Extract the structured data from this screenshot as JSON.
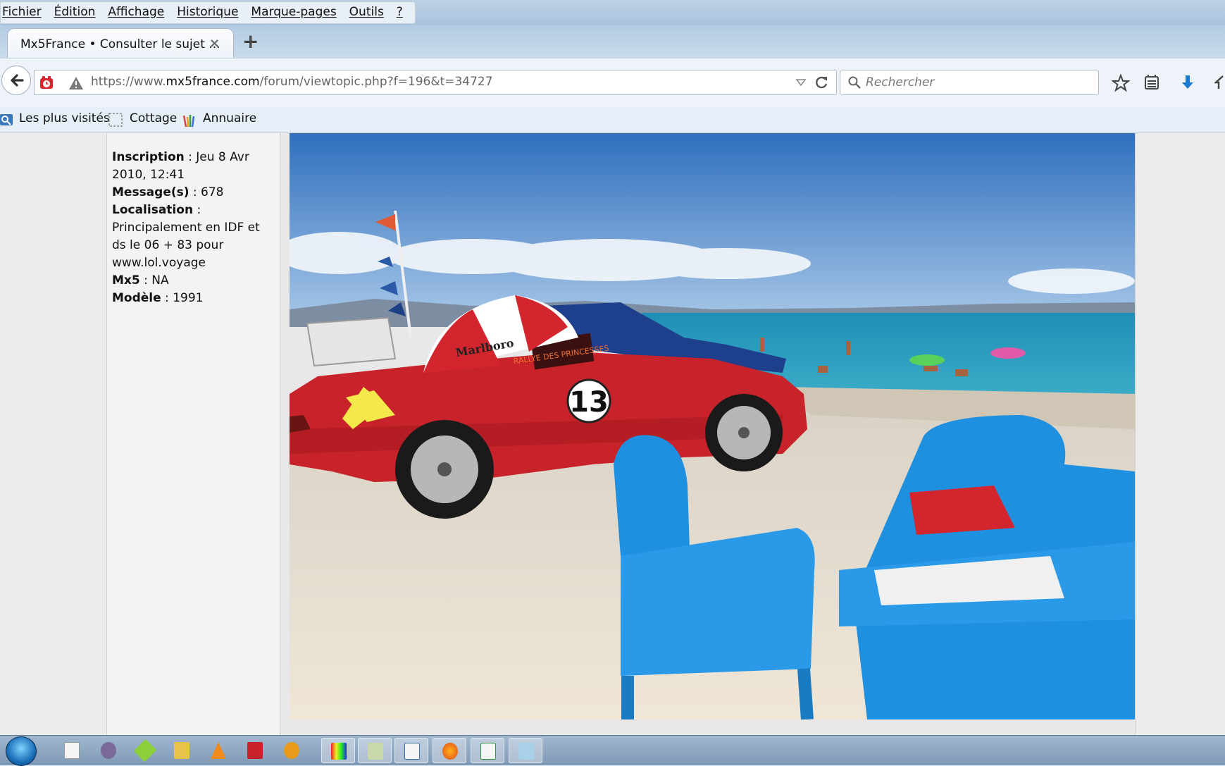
{
  "menu": [
    "Fichier",
    "Édition",
    "Affichage",
    "Historique",
    "Marque-pages",
    "Outils",
    "?"
  ],
  "tab": {
    "title": "Mx5France • Consulter le sujet ...",
    "close": "×",
    "new_tab": "+"
  },
  "urlbar": {
    "url_prefix": "https://www.",
    "url_domain": "mx5france.com",
    "url_path": "/forum/viewtopic.php?f=196&t=34727"
  },
  "search": {
    "placeholder": "Rechercher"
  },
  "bookmarks": [
    "Les plus visités",
    "Cottage",
    "Annuaire"
  ],
  "profile": {
    "inscription_label": "Inscription",
    "inscription_value": " : Jeu 8 Avr 2010, 12:41",
    "messages_label": "Message(s)",
    "messages_value": " : 678",
    "localisation_label": "Localisation",
    "localisation_value": " : Principalement en IDF et ds le 06 + 83 pour www.lol.voyage",
    "mx5_label": "Mx5",
    "mx5_value": " : NA",
    "modele_label": "Modèle",
    "modele_value": " : 1991"
  },
  "photo": {
    "car_number": "13",
    "umbrella_text": "Marlboro",
    "sign_text": "RALLYE DES PRINCESSES"
  },
  "colors": {
    "car_red": "#c8222a",
    "chair_blue": "#1f8fe0",
    "sky": "#3f7cc4",
    "sea": "#2a9bc0",
    "sand": "#e9dfcf"
  },
  "taskbar_icons": [
    "notepad-icon",
    "app-icon",
    "app-icon",
    "explorer-icon",
    "vlc-icon",
    "pdf-icon",
    "app-icon",
    "paint-icon",
    "app-icon",
    "document-icon",
    "firefox-icon",
    "spreadsheet-icon",
    "app-icon"
  ]
}
